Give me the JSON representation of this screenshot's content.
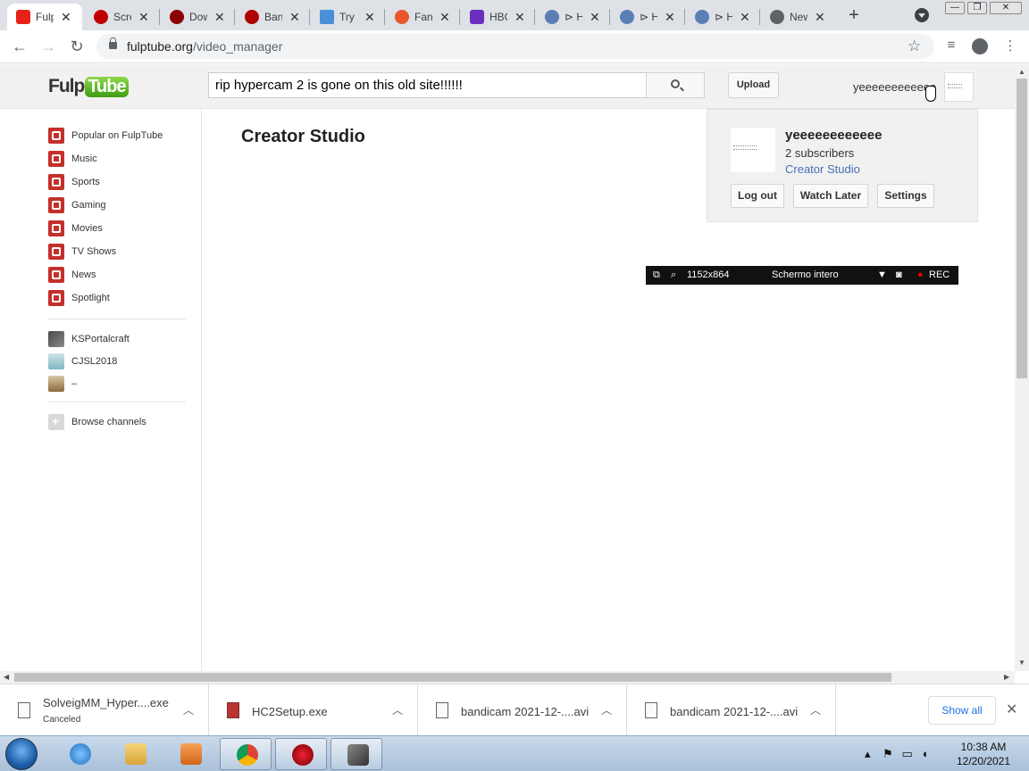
{
  "browser": {
    "tabs": [
      {
        "title": "Fulp",
        "favicon_color": "#e62117",
        "active": true
      },
      {
        "title": "Scre",
        "favicon_color": "#c00000"
      },
      {
        "title": "Dow",
        "favicon_color": "#8b0000"
      },
      {
        "title": "Ban",
        "favicon_color": "#b00000"
      },
      {
        "title": "Try",
        "favicon_color": "#4a90d9"
      },
      {
        "title": "Fan",
        "favicon_color": "#e8572c"
      },
      {
        "title": "HBO",
        "favicon_color": "#6b2fbf"
      },
      {
        "title": "⊳ H",
        "favicon_color": "#5b7fb5"
      },
      {
        "title": "⊳ H",
        "favicon_color": "#5b7fb5"
      },
      {
        "title": "⊳ H",
        "favicon_color": "#5b7fb5"
      },
      {
        "title": "New",
        "favicon_color": "#5f6368"
      }
    ],
    "new_tab": "+",
    "window_controls": {
      "minimize": "—",
      "restore": "❐",
      "close": "✕"
    },
    "url_host": "fulptube.org",
    "url_path": "/video_manager"
  },
  "site": {
    "logo_part1": "Fulp",
    "logo_part2": "Tube",
    "search_query": "rip hypercam 2 is gone on this old site!!!!!!",
    "upload_label": "Upload",
    "username": "yeeeeeeeeeeee"
  },
  "guide": {
    "items": [
      {
        "label": "Popular on FulpTube",
        "icon": "popular-icon"
      },
      {
        "label": "Music",
        "icon": "music-icon"
      },
      {
        "label": "Sports",
        "icon": "sports-icon"
      },
      {
        "label": "Gaming",
        "icon": "gaming-icon"
      },
      {
        "label": "Movies",
        "icon": "movies-icon"
      },
      {
        "label": "TV Shows",
        "icon": "tv-icon"
      },
      {
        "label": "News",
        "icon": "news-icon"
      },
      {
        "label": "Spotlight",
        "icon": "spotlight-icon"
      }
    ],
    "subscriptions": [
      {
        "label": "KSPortalcraft"
      },
      {
        "label": "CJSL2018"
      },
      {
        "label": "–"
      }
    ],
    "browse_label": "Browse channels"
  },
  "main": {
    "title": "Creator Studio"
  },
  "account_menu": {
    "name": "yeeeeeeeeeeee",
    "subscribers": "2 subscribers",
    "studio_link": "Creator Studio",
    "buttons": [
      "Log out",
      "Watch Later",
      "Settings"
    ]
  },
  "recorder": {
    "resolution": "1152x864",
    "mode": "Schermo intero",
    "rec_label": "REC",
    "rec_color": "#e00000"
  },
  "downloads": {
    "items": [
      {
        "name": "SolveigMM_Hyper....exe",
        "status": "Canceled"
      },
      {
        "name": "HC2Setup.exe",
        "status": ""
      },
      {
        "name": "bandicam 2021-12-....avi",
        "status": ""
      },
      {
        "name": "bandicam 2021-12-....avi",
        "status": ""
      }
    ],
    "show_all": "Show all"
  },
  "taskbar": {
    "time": "10:38 AM",
    "date": "12/20/2021"
  }
}
